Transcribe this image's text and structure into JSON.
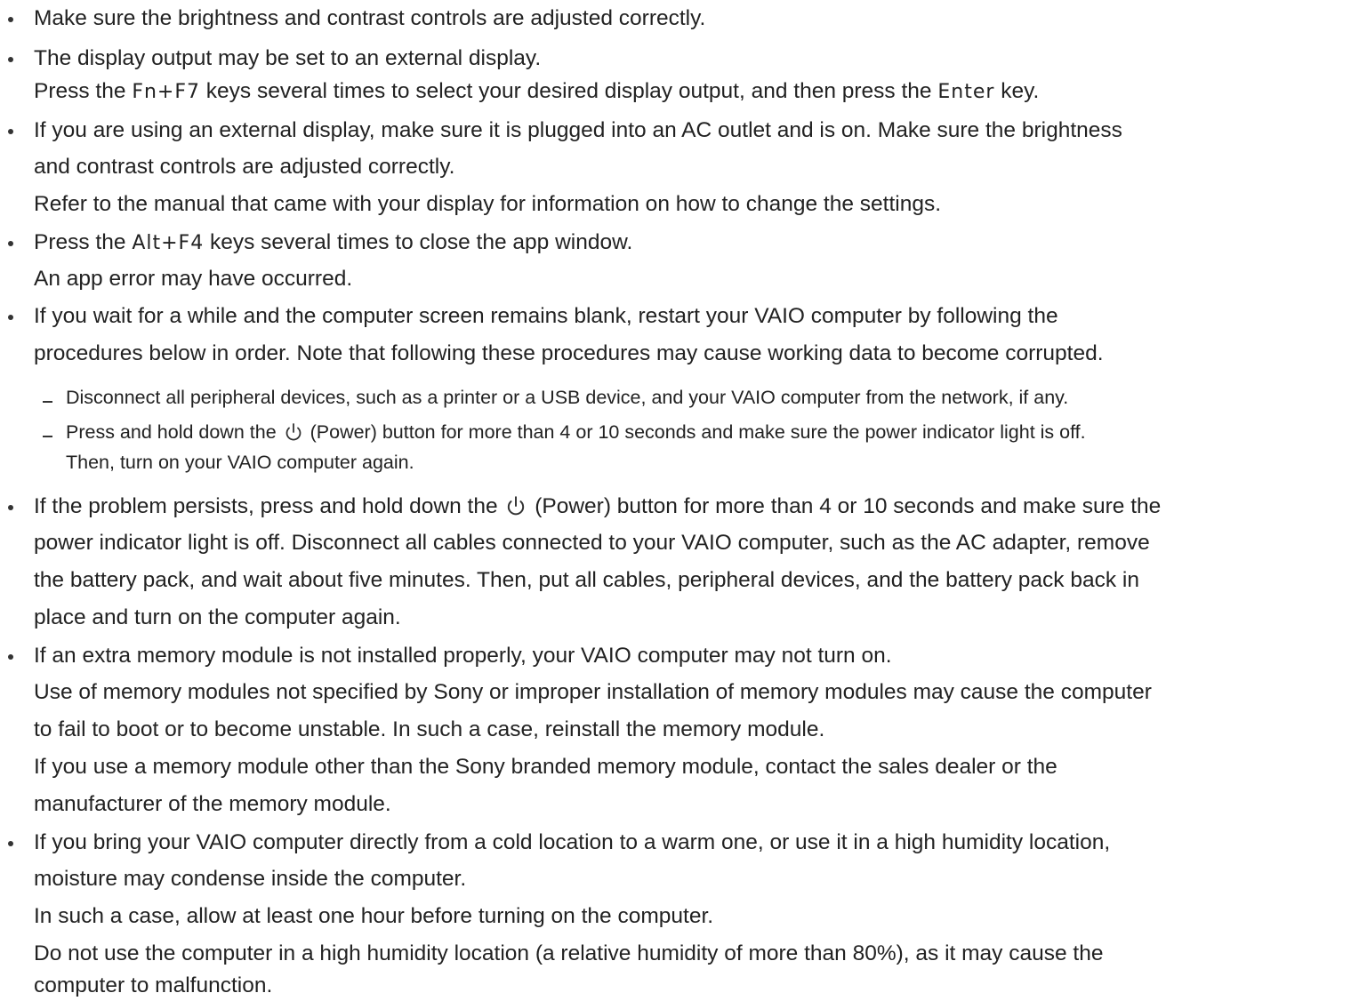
{
  "items": [
    {
      "text": "Make sure the brightness and contrast controls are adjusted correctly."
    },
    {
      "line1": "The display output may be set to an external display.",
      "line2_a": "Press the ",
      "key1": "Fn+F7",
      "line2_b": " keys several times to select your desired display output, and then press the ",
      "key2": "Enter",
      "line2_c": " key."
    },
    {
      "line1": "If you are using an external display, make sure it is plugged into an AC outlet and is on. Make sure the brightness",
      "line2": "and contrast controls are adjusted correctly.",
      "line3": "Refer to the manual that came with your display for information on how to change the settings."
    },
    {
      "line1_a": "Press the ",
      "key": "Alt+F4",
      "line1_b": " keys several times to close the app window.",
      "line2": "An app error may have occurred."
    },
    {
      "line1": "If you wait for a while and the computer screen remains blank, restart your VAIO computer by following the",
      "line2": "procedures below in order. Note that following these procedures may cause working data to become corrupted.",
      "sub1": "Disconnect all peripheral devices, such as a printer or a USB device, and your VAIO computer from the network, if any.",
      "sub2_a": "Press and hold down the ",
      "sub2_b": " (Power) button for more than 4 or 10 seconds and make sure the power indicator light is off.",
      "sub2_line2": "Then, turn on your VAIO computer again."
    },
    {
      "line1_a": "If the problem persists, press and hold down the ",
      "line1_b": " (Power) button for more than 4 or 10 seconds and make sure the",
      "line2": "power indicator light is off. Disconnect all cables connected to your VAIO computer, such as the AC adapter, remove",
      "line3": "the battery pack, and wait about five minutes. Then, put all cables, peripheral devices, and the battery pack back in",
      "line4": "place and turn on the computer again."
    },
    {
      "line1": "If an extra memory module is not installed properly, your VAIO computer may not turn on.",
      "line2": "Use of memory modules not specified by Sony or improper installation of memory modules may cause the computer",
      "line3": "to fail to boot or to become unstable. In such a case, reinstall the memory module.",
      "line4": "If you use a memory module other than the Sony branded memory module, contact the sales dealer or the",
      "line5": "manufacturer of the memory module."
    },
    {
      "line1": "If you bring your VAIO computer directly from a cold location to a warm one, or use it in a high humidity location,",
      "line2": "moisture may condense inside the computer.",
      "line3": "In such a case, allow at least one hour before turning on the computer.",
      "line4": "Do not use the computer in a high humidity location (a relative humidity of more than 80%), as it may cause the",
      "line5": "computer to malfunction."
    }
  ],
  "icon": "power-icon",
  "colors": {
    "text": "#222222",
    "background": "#ffffff"
  }
}
